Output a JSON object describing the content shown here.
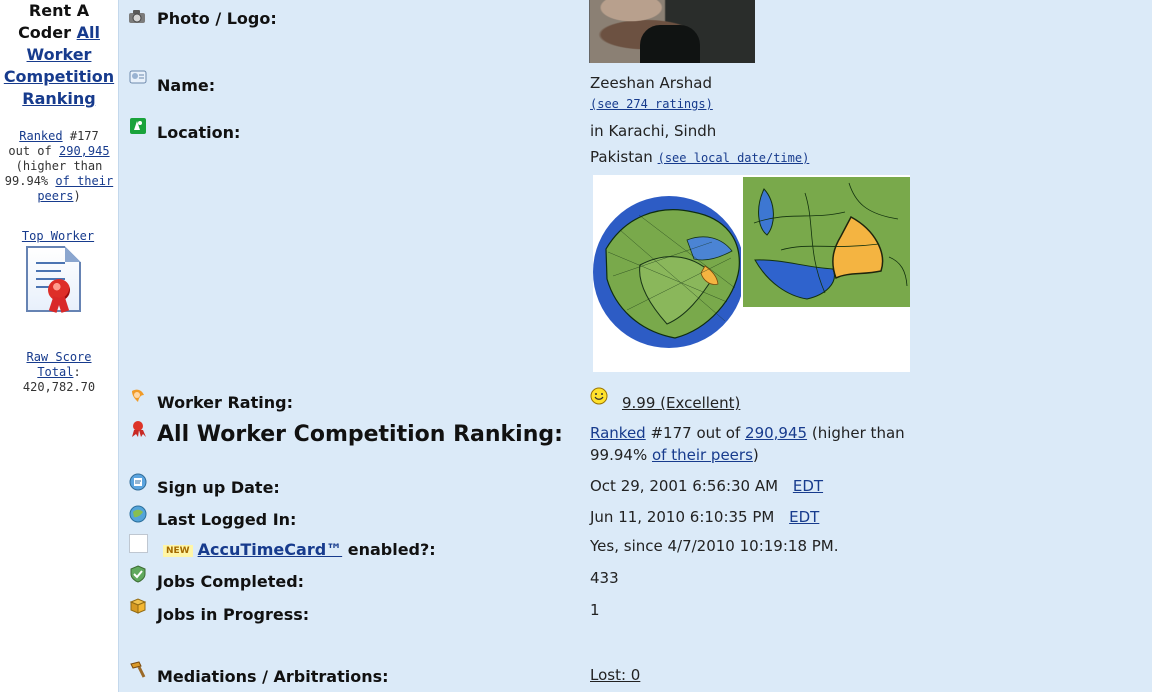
{
  "sidebar": {
    "title_line_1": "Rent A",
    "title_line_2": "Coder",
    "all_link": "All",
    "worker_link": "Worker",
    "competition_link": "Competition",
    "ranking_link": "Ranking",
    "ranked_link": "Ranked",
    "rank_number": "#177",
    "out_of": "out of",
    "peer_total_link": "290,945",
    "higher_than": "(higher than",
    "percent": "99.94%",
    "of_their_link": "of their",
    "peers_link": "peers",
    "peers_close": ")",
    "top_worker_link": "Top Worker",
    "raw_score_link": "Raw Score",
    "total_link": "Total",
    "total_colon": ":",
    "raw_score_value": "420,782.70"
  },
  "profile": {
    "photo_label": "Photo / Logo:",
    "name_label": "Name:",
    "name_value": "Zeeshan Arshad",
    "ratings_link": "(see 274 ratings)",
    "location_label": "Location:",
    "location_line_1": "in Karachi, Sindh",
    "location_country": "Pakistan",
    "local_time_link": "(see local date/time)",
    "worker_rating_label": "Worker Rating:",
    "worker_rating_value": "9.99 (Excellent)",
    "ranking_label": "All Worker Competition Ranking:",
    "ranking_ranked_link": "Ranked",
    "ranking_text_1": "#177 out of",
    "ranking_total_link": "290,945",
    "ranking_text_2": "(higher than",
    "ranking_percent": "99.94%",
    "ranking_peers_link": "of their peers",
    "ranking_close": ")",
    "signup_label": "Sign up Date:",
    "signup_value": "Oct 29, 2001 6:56:30 AM",
    "signup_timezone": "EDT",
    "last_logged_label": "Last Logged In:",
    "last_logged_value": "Jun 11, 2010 6:10:35 PM",
    "last_logged_timezone": "EDT",
    "new_badge": "NEW",
    "accutime_link": "AccuTimeCard™",
    "accutime_label_suffix": " enabled?:",
    "accutime_value": "Yes, since 4/7/2010 10:19:18 PM.",
    "jobs_completed_label": "Jobs Completed:",
    "jobs_completed_value": "433",
    "jobs_progress_label": "Jobs in Progress:",
    "jobs_progress_value": "1",
    "mediations_label": "Mediations / Arbitrations:",
    "mediations_value": "Lost: 0"
  },
  "colors": {
    "panel_background": "#dbeaf8",
    "link": "#173b8d",
    "map_ocean": "#2d5cc5",
    "map_land": "#79a94b",
    "map_highlight": "#f4b441"
  },
  "icons": {
    "photo": "camera-icon",
    "name": "name-card-icon",
    "location": "location-icon",
    "rating": "rating-icon",
    "ranking": "ribbon-icon",
    "signup": "signup-icon",
    "logged": "globe-icon",
    "jobs_completed": "shield-icon",
    "jobs_progress": "box-icon",
    "mediations": "hammer-icon"
  }
}
